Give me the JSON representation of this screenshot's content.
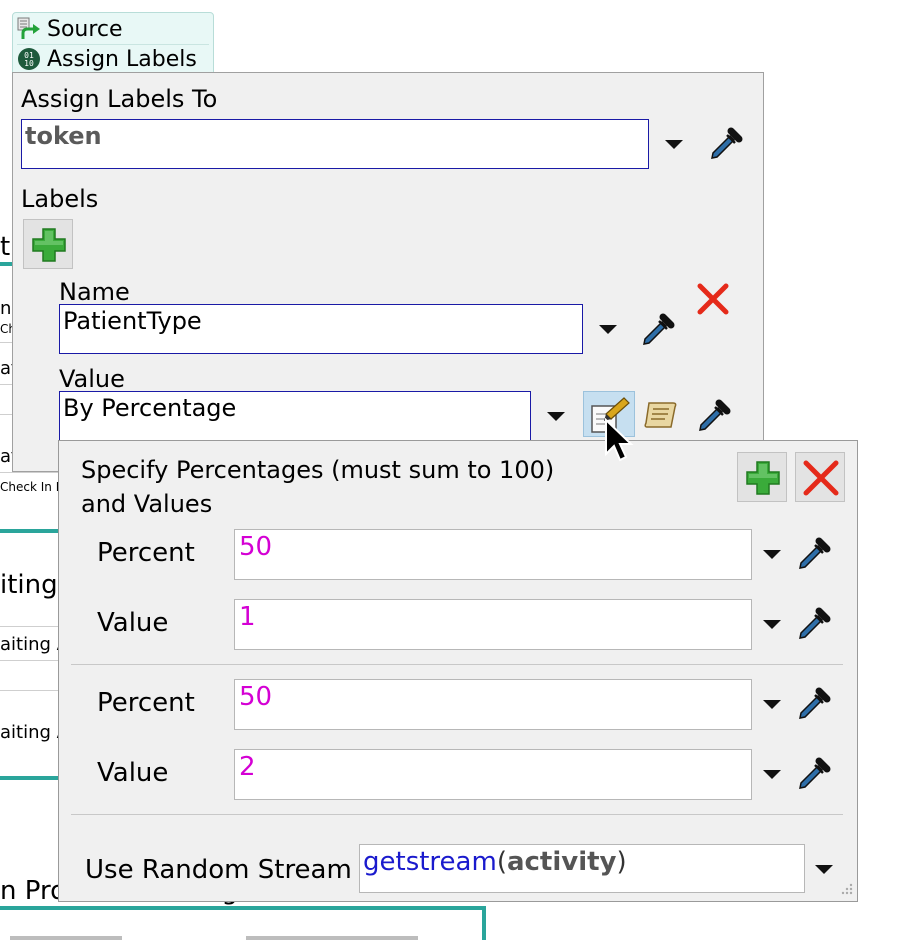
{
  "background": {
    "snippet_th": "th",
    "snippet_ne": "ne",
    "snippet_ch": "Ch",
    "snippet_aff_1": "aff",
    "snippet_aff_2": "aff",
    "snippet_check_in": "Check In D",
    "snippet_iting": "iting A",
    "snippet_aiting_1": "aiting A",
    "snippet_aiting_2": "aiting A",
    "snippet_process": "n Process: Waiting Process"
  },
  "activity_list": {
    "items": [
      {
        "label": "Source",
        "icon": "source-icon"
      },
      {
        "label": "Assign Labels",
        "icon": "assign-labels-icon"
      }
    ]
  },
  "properties": {
    "assign_to_label": "Assign Labels To",
    "assign_to_value": "token",
    "labels_header": "Labels",
    "name_label": "Name",
    "name_value": "PatientType",
    "value_label": "Value",
    "value_value": "By Percentage"
  },
  "percentages": {
    "title_line1": "Specify Percentages (must sum to 100)",
    "title_line2": "and Values",
    "rows": [
      {
        "percent_label": "Percent",
        "percent": "50",
        "value_label": "Value",
        "value": "1"
      },
      {
        "percent_label": "Percent",
        "percent": "50",
        "value_label": "Value",
        "value": "2"
      }
    ],
    "stream_label": "Use Random Stream",
    "stream_func": "getstream",
    "stream_open": "(",
    "stream_arg": "activity",
    "stream_close": ")"
  },
  "colors": {
    "accent_teal": "#2aa59b",
    "field_border": "#1a1aa6",
    "value_magenta": "#d400d4",
    "delete_red": "#e52a1a",
    "add_green": "#37a537",
    "func_blue": "#1a1acd"
  }
}
